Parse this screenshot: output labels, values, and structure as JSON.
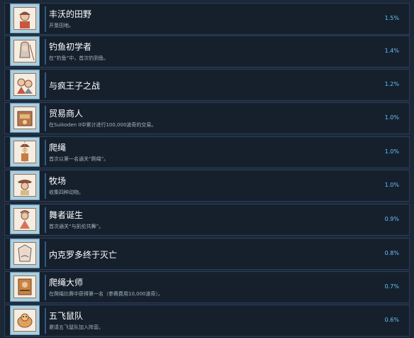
{
  "achievements": [
    {
      "title": "丰沃的田野",
      "description": "开垦田地。",
      "percent": "1.5%",
      "icon": "farmer-portrait-icon"
    },
    {
      "title": "钓鱼初学者",
      "description": "在“钓鱼”中，首次钓到鱼。",
      "percent": "1.4%",
      "icon": "fishing-girl-icon"
    },
    {
      "title": "与疯王子之战",
      "description": "",
      "percent": "1.2%",
      "icon": "mad-prince-battle-icon"
    },
    {
      "title": "贸易商人",
      "description": "在Suikoden II中累计进行100,000波奇的交易。",
      "percent": "1.0%",
      "icon": "trade-merchant-icon"
    },
    {
      "title": "爬绳",
      "description": "首次以第一名通关“爬绳”。",
      "percent": "1.0%",
      "icon": "rope-climber-icon"
    },
    {
      "title": "牧场",
      "description": "收集四种动物。",
      "percent": "1.0%",
      "icon": "ranch-animals-icon"
    },
    {
      "title": "舞者诞生",
      "description": "首次通关“与凯伦共舞”。",
      "percent": "0.9%",
      "icon": "dancer-icon"
    },
    {
      "title": "内克罗多终于灭亡",
      "description": "",
      "percent": "0.8%",
      "icon": "vampire-defeat-icon"
    },
    {
      "title": "爬绳大师",
      "description": "在爬绳比赛中获得第一名（参赛费用10,000波奇）。",
      "percent": "0.7%",
      "icon": "rope-master-icon"
    },
    {
      "title": "五飞鼠队",
      "description": "邀请五飞鼠队加入阵营。",
      "percent": "0.6%",
      "icon": "flying-squirrel-icon"
    }
  ]
}
